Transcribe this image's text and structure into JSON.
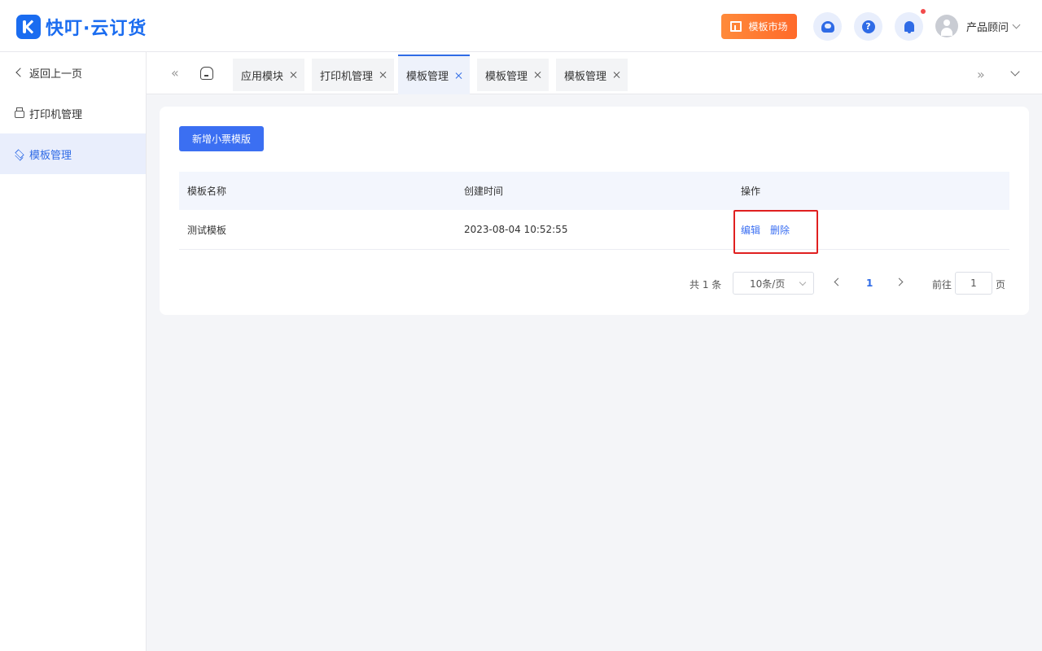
{
  "header": {
    "logo_text": "快叮·云订货",
    "market_label": "模板市场",
    "help_glyph": "?",
    "user_name": "产品顾问",
    "icons": [
      "customer-service-icon",
      "help-icon",
      "bell-icon",
      "avatar",
      "chevron-down-icon"
    ],
    "accent_color": "#2f6be6",
    "market_color": "#ff7a33"
  },
  "sidebar": {
    "items": [
      {
        "label": "返回上一页",
        "icon": "chevron-left-icon"
      },
      {
        "label": "打印机管理",
        "icon": "printer-icon"
      },
      {
        "label": "模板管理",
        "icon": "layers-icon",
        "active": true
      }
    ]
  },
  "tabs": {
    "items": [
      {
        "label": "应用模块"
      },
      {
        "label": "打印机管理"
      },
      {
        "label": "模板管理",
        "active": true
      },
      {
        "label": "模板管理"
      },
      {
        "label": "模板管理"
      }
    ]
  },
  "main": {
    "add_button": "新增小票模版",
    "table": {
      "headers": [
        "模板名称",
        "创建时间",
        "操作"
      ],
      "rows": [
        {
          "name": "测试模板",
          "created": "2023-08-04 10:52:55",
          "actions": [
            "编辑",
            "删除"
          ]
        }
      ]
    },
    "pagination": {
      "total": "共 1 条",
      "page_size": "10条/页",
      "current_page": "1",
      "goto_label": "前往",
      "goto_value": "1",
      "page_unit": "页"
    },
    "highlight_color": "#e02020"
  }
}
